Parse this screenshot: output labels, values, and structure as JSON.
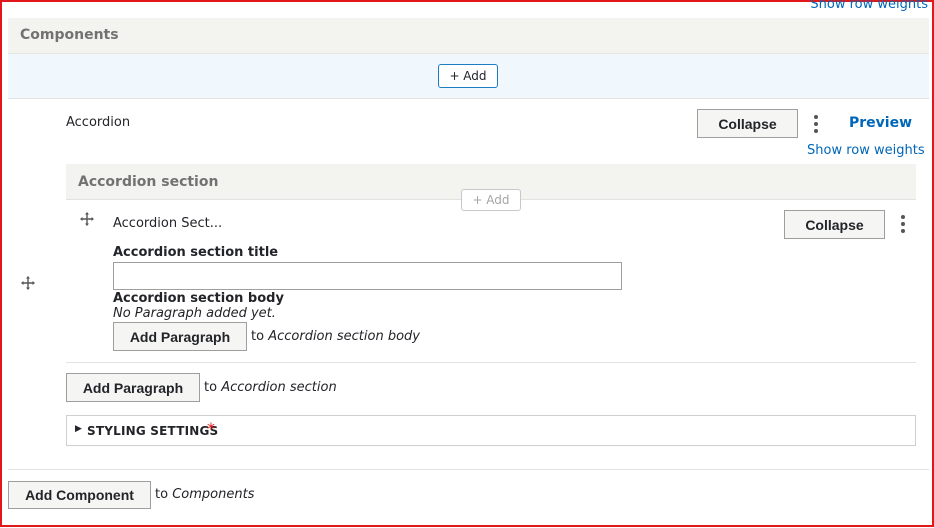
{
  "top_link": "Show row weights",
  "components": {
    "header": "Components",
    "add_button": "+ Add",
    "add_component_button": "Add Component",
    "add_component_to": "to",
    "add_component_target": "Components"
  },
  "accordion": {
    "label": "Accordion",
    "collapse_button": "Collapse",
    "preview_link": "Preview",
    "show_row_weights": "Show row weights",
    "section_header": "Accordion section",
    "section_add_button": "+ Add",
    "add_paragraph_button": "Add Paragraph",
    "add_paragraph_to": "to",
    "add_paragraph_target": "Accordion section",
    "styling_settings": "STYLING SETTINGS",
    "required_mark": "*"
  },
  "section_item": {
    "label": "Accordion Sect...",
    "collapse_button": "Collapse",
    "title_label": "Accordion section title",
    "title_value": "",
    "body_label": "Accordion section body",
    "no_paragraph_text": "No Paragraph added yet.",
    "add_paragraph_button": "Add Paragraph",
    "add_paragraph_to": "to",
    "add_paragraph_target": "Accordion section body"
  },
  "colors": {
    "link": "#0066b8",
    "header_bg": "#f3f3ef",
    "add_row_bg": "#f1f8fd",
    "border": "#e2171b",
    "required": "#e2171b"
  }
}
